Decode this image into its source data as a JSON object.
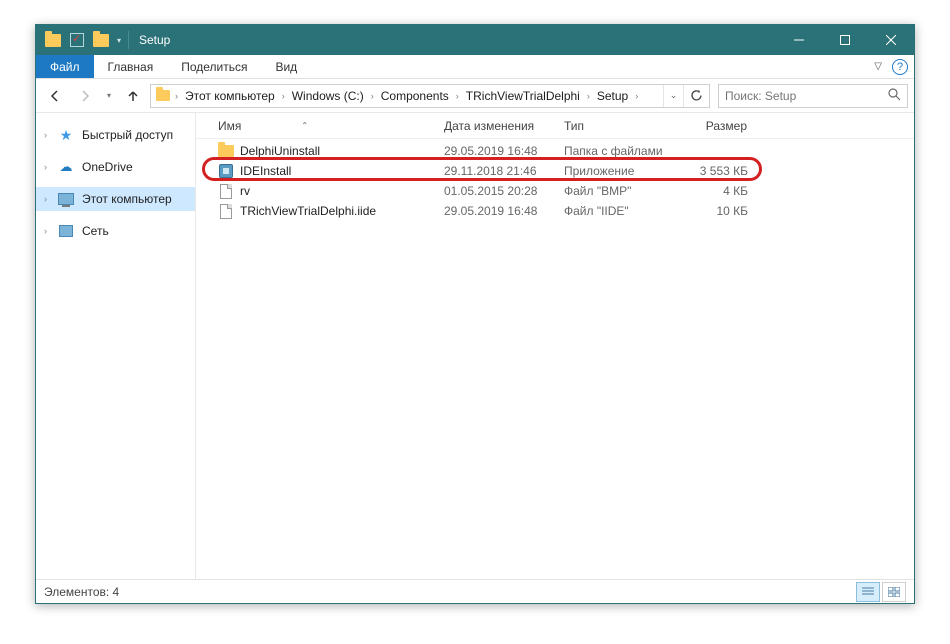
{
  "window": {
    "title": "Setup"
  },
  "ribbon": {
    "file": "Файл",
    "home": "Главная",
    "share": "Поделиться",
    "view": "Вид"
  },
  "breadcrumb": {
    "items": [
      "Этот компьютер",
      "Windows (C:)",
      "Components",
      "TRichViewTrialDelphi",
      "Setup"
    ]
  },
  "search": {
    "placeholder": "Поиск: Setup"
  },
  "nav": {
    "quick": "Быстрый доступ",
    "onedrive": "OneDrive",
    "thispc": "Этот компьютер",
    "network": "Сеть"
  },
  "columns": {
    "name": "Имя",
    "date": "Дата изменения",
    "type": "Тип",
    "size": "Размер"
  },
  "rows": [
    {
      "name": "DelphiUninstall",
      "date": "29.05.2019 16:48",
      "type": "Папка с файлами",
      "size": "",
      "icon": "folder"
    },
    {
      "name": "IDEInstall",
      "date": "29.11.2018 21:46",
      "type": "Приложение",
      "size": "3 553 КБ",
      "icon": "exe"
    },
    {
      "name": "rv",
      "date": "01.05.2015 20:28",
      "type": "Файл \"BMP\"",
      "size": "4 КБ",
      "icon": "doc"
    },
    {
      "name": "TRichViewTrialDelphi.iide",
      "date": "29.05.2019 16:48",
      "type": "Файл \"IIDE\"",
      "size": "10 КБ",
      "icon": "doc"
    }
  ],
  "status": {
    "count_label": "Элементов: 4"
  },
  "highlight_row_index": 1
}
